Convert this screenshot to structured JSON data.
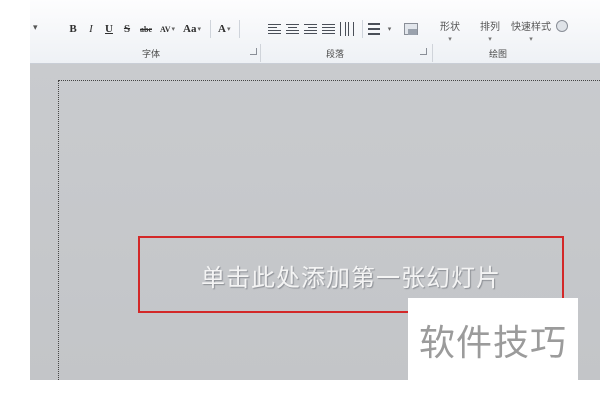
{
  "ribbon": {
    "edge_mark": "▾",
    "font_group": {
      "label": "字体",
      "bold": "B",
      "italic": "I",
      "underline": "U",
      "shadow": "S",
      "strikethrough": "abc",
      "char_spacing": "AV",
      "change_case": "Aa",
      "font_color": "A"
    },
    "paragraph_group": {
      "label": "段落"
    },
    "drawing_group": {
      "label": "绘图",
      "shape": "形状",
      "arrange": "排列",
      "quick_styles": "快速样式"
    }
  },
  "slide": {
    "title_placeholder": "单击此处添加第一张幻灯片"
  },
  "watermark": "软件技巧",
  "colors": {
    "highlight_border": "#d32828",
    "workspace": "#c6c8cb"
  }
}
